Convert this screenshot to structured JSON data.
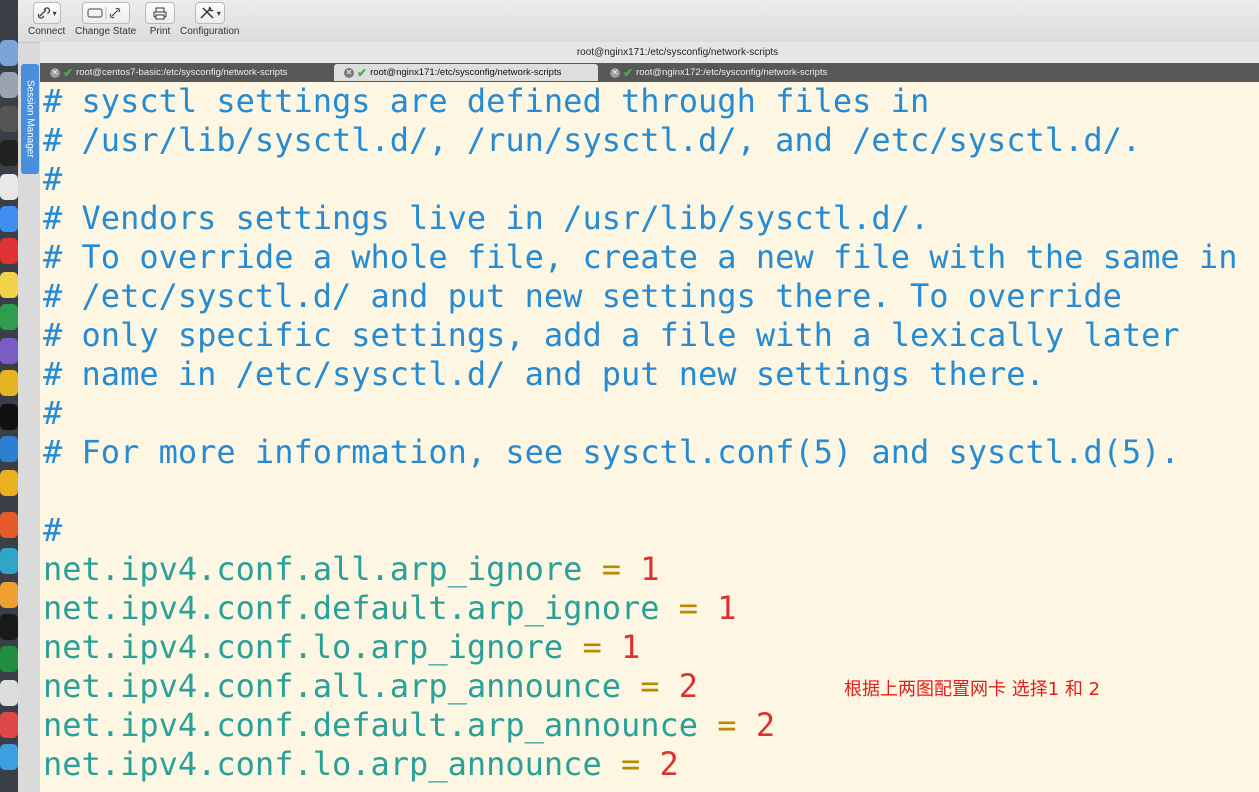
{
  "toolbar": {
    "connect_label": "Connect",
    "change_state_label": "Change State",
    "print_label": "Print",
    "configuration_label": "Configuration"
  },
  "window": {
    "title": "root@nginx171:/etc/sysconfig/network-scripts"
  },
  "session_manager_label": "Session Manager",
  "tabs": [
    {
      "label": "root@centos7-basic:/etc/sysconfig/network-scripts",
      "active": false
    },
    {
      "label": "root@nginx171:/etc/sysconfig/network-scripts",
      "active": true
    },
    {
      "label": "root@nginx172:/etc/sysconfig/network-scripts",
      "active": false
    }
  ],
  "terminal": {
    "comments": [
      "# sysctl settings are defined through files in",
      "# /usr/lib/sysctl.d/, /run/sysctl.d/, and /etc/sysctl.d/.",
      "#",
      "# Vendors settings live in /usr/lib/sysctl.d/.",
      "# To override a whole file, create a new file with the same in",
      "# /etc/sysctl.d/ and put new settings there. To override",
      "# only specific settings, add a file with a lexically later",
      "# name in /etc/sysctl.d/ and put new settings there.",
      "#",
      "# For more information, see sysctl.conf(5) and sysctl.d(5).",
      "",
      "#"
    ],
    "settings": [
      {
        "key": "net.ipv4.conf.all.arp_ignore",
        "eq": "=",
        "value": "1"
      },
      {
        "key": "net.ipv4.conf.default.arp_ignore",
        "eq": "=",
        "value": "1"
      },
      {
        "key": "net.ipv4.conf.lo.arp_ignore",
        "eq": "=",
        "value": "1"
      },
      {
        "key": "net.ipv4.conf.all.arp_announce",
        "eq": "=",
        "value": "2"
      },
      {
        "key": "net.ipv4.conf.default.arp_announce",
        "eq": "=",
        "value": "2"
      },
      {
        "key": "net.ipv4.conf.lo.arp_announce",
        "eq": "=",
        "value": "2"
      }
    ]
  },
  "annotation": "根据上两图配置网卡  选择1 和 2",
  "colors": {
    "terminal_bg": "#fdf6e3",
    "comment": "#268bd2",
    "key": "#2aa198",
    "operator": "#b58900",
    "number": "#dc322f",
    "annotation": "#e0201b"
  },
  "icons": {
    "connect": "link-icon",
    "change_state": "refresh-icon",
    "print": "printer-icon",
    "configuration": "tools-icon",
    "tab_status": "checkmark-icon",
    "tab_close": "close-icon"
  }
}
